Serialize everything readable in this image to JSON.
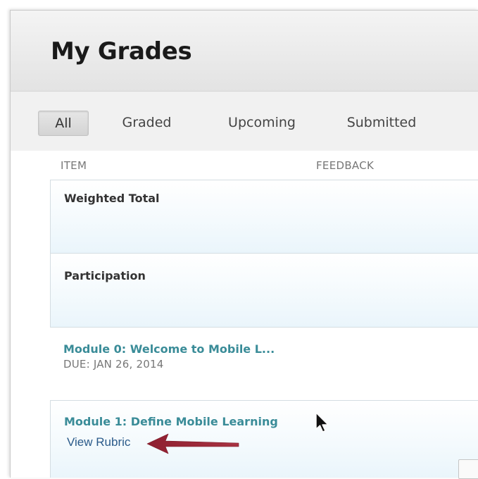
{
  "header": {
    "title": "My Grades"
  },
  "tabs": [
    {
      "label": "All",
      "active": true
    },
    {
      "label": "Graded",
      "active": false
    },
    {
      "label": "Upcoming",
      "active": false
    },
    {
      "label": "Submitted",
      "active": false
    }
  ],
  "columns": {
    "item": "ITEM",
    "feedback": "FEEDBACK"
  },
  "rows": [
    {
      "title": "Weighted Total"
    },
    {
      "title": "Participation"
    },
    {
      "title": "Module 0: Welcome to Mobile L...",
      "due": "DUE: JAN 26, 2014"
    },
    {
      "title": "Module 1: Define Mobile Learning",
      "link": "View Rubric"
    }
  ],
  "colors": {
    "accent_link": "#3a8c98",
    "rubric_link": "#2a5a8a",
    "annotation_arrow": "#9b2335"
  }
}
